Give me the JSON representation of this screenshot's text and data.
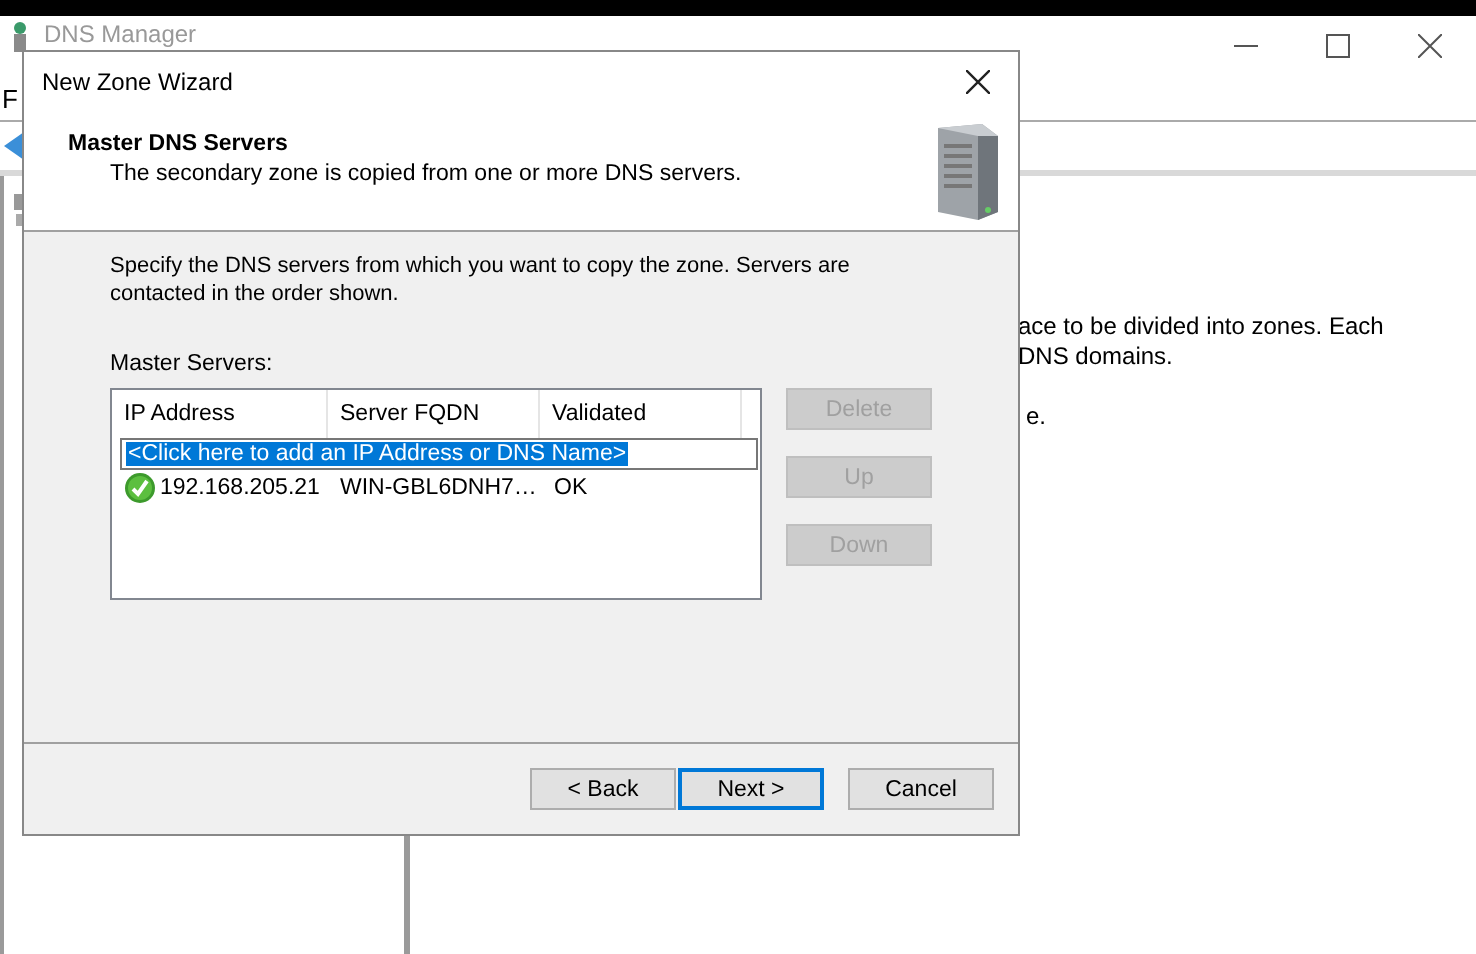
{
  "background_window": {
    "title": "DNS Manager",
    "menu_item": "F",
    "description_lines": [
      "ace to be divided into zones. Each",
      "DNS domains.",
      "e."
    ]
  },
  "dialog": {
    "title": "New Zone Wizard",
    "header": {
      "title": "Master DNS Servers",
      "subtitle": "The secondary zone is copied from one or more DNS servers."
    },
    "instructions": "Specify the DNS servers from which you want to copy the zone.  Servers are contacted in the order shown.",
    "list_label": "Master Servers:",
    "columns": [
      "IP Address",
      "Server FQDN",
      "Validated"
    ],
    "add_row": {
      "text": "<Click here to add an IP Address or DNS Name>",
      "selected": true
    },
    "rows": [
      {
        "ip": "192.168.205.21",
        "fqdn": "WIN-GBL6DNH7…",
        "validated": "OK",
        "kind": "ok"
      }
    ],
    "side_buttons": [
      {
        "label": "Delete",
        "disabled": true
      },
      {
        "label": "Up",
        "disabled": true
      },
      {
        "label": "Down",
        "disabled": true
      }
    ],
    "footer_buttons": [
      {
        "label": "< Back",
        "default": false
      },
      {
        "label": "Next >",
        "default": true
      },
      {
        "label": "Cancel",
        "default": false
      }
    ]
  }
}
